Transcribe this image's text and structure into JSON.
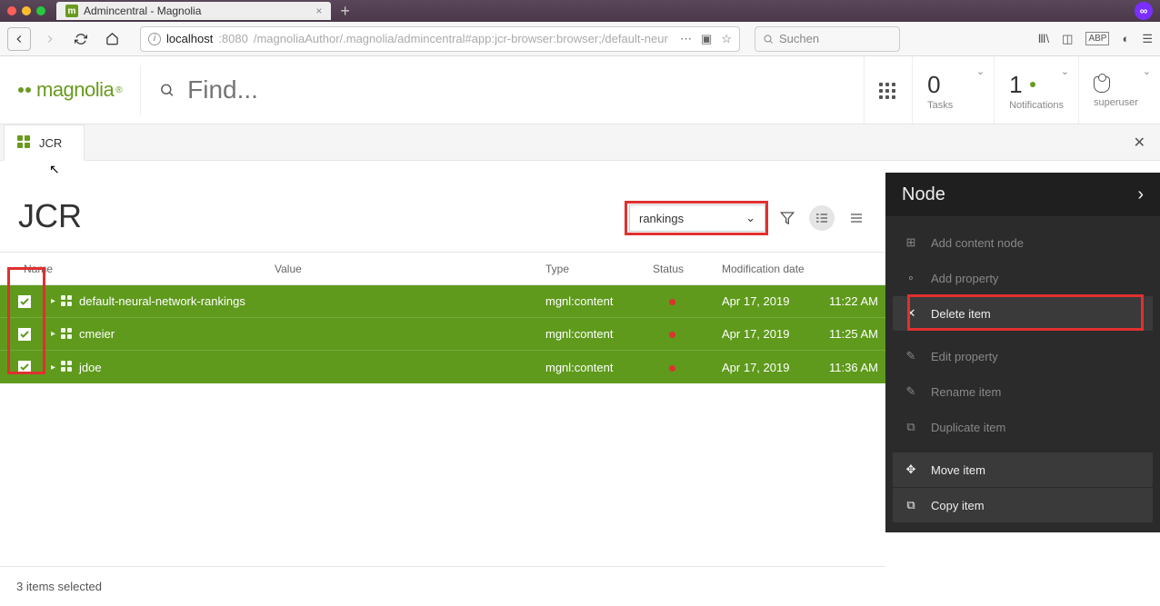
{
  "browser": {
    "tab_title": "Admincentral - Magnolia",
    "url_prefix": "localhost",
    "url_port": ":8080",
    "url_path": "/magnoliaAuthor/.magnolia/admincentral#app:jcr-browser:browser;/default-neur",
    "search_placeholder": "Suchen"
  },
  "header": {
    "logo": "magnolia",
    "find_placeholder": "Find...",
    "tasks_count": "0",
    "tasks_label": "Tasks",
    "notifications_count": "1",
    "notifications_label": "Notifications",
    "user_label": "superuser"
  },
  "tab": {
    "label": "JCR"
  },
  "page": {
    "title": "JCR",
    "workspace": "rankings",
    "columns": {
      "name": "Name",
      "value": "Value",
      "type": "Type",
      "status": "Status",
      "moddate": "Modification date"
    }
  },
  "rows": [
    {
      "name": "default-neural-network-rankings",
      "type": "mgnl:content",
      "date": "Apr 17, 2019",
      "time": "11:22 AM"
    },
    {
      "name": "cmeier",
      "type": "mgnl:content",
      "date": "Apr 17, 2019",
      "time": "11:25 AM"
    },
    {
      "name": "jdoe",
      "type": "mgnl:content",
      "date": "Apr 17, 2019",
      "time": "11:36 AM"
    }
  ],
  "panel": {
    "title": "Node",
    "actions": {
      "add_node": "Add content node",
      "add_prop": "Add property",
      "delete": "Delete item",
      "edit_prop": "Edit property",
      "rename": "Rename item",
      "duplicate": "Duplicate item",
      "move": "Move item",
      "copy": "Copy item"
    }
  },
  "footer": {
    "status": "3 items selected"
  }
}
